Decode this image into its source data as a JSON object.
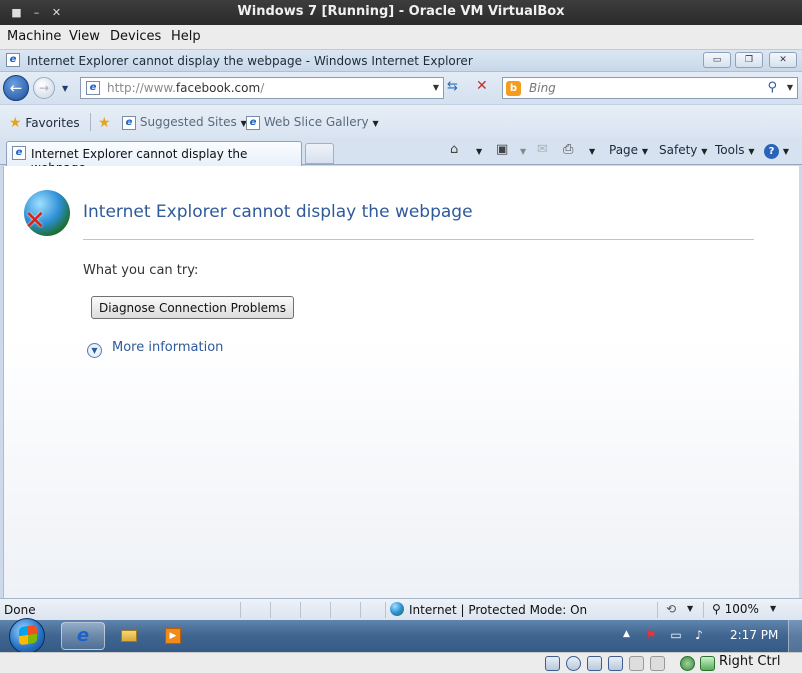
{
  "host": {
    "title": "Windows 7 [Running] - Oracle VM VirtualBox",
    "menu": [
      "Machine",
      "View",
      "Devices",
      "Help"
    ],
    "statusbar_label": "Right Ctrl"
  },
  "ie": {
    "window_title": "Internet Explorer cannot display the webpage - Windows Internet Explorer",
    "address": {
      "prefix": "http://www.",
      "domain": "facebook.com",
      "suffix": "/"
    },
    "search_placeholder": "Bing",
    "favorites": {
      "favorites_label": "Favorites",
      "suggested_label": "Suggested Sites",
      "webslice_label": "Web Slice Gallery"
    },
    "tab_title": "Internet Explorer cannot display the webpage",
    "commands": {
      "page": "Page",
      "safety": "Safety",
      "tools": "Tools"
    },
    "status": {
      "left": "Done",
      "zone": "Internet | Protected Mode: On",
      "zoom": "100%"
    }
  },
  "content": {
    "title": "Internet Explorer cannot display the webpage",
    "try_label": "What you can try:",
    "diagnose_button": "Diagnose Connection Problems",
    "more_info": "More information"
  },
  "taskbar": {
    "clock": "2:17 PM"
  },
  "colors": {
    "link_blue": "#2e5a9a",
    "taskbar": "#3f6590",
    "error_red": "#d6231c"
  }
}
